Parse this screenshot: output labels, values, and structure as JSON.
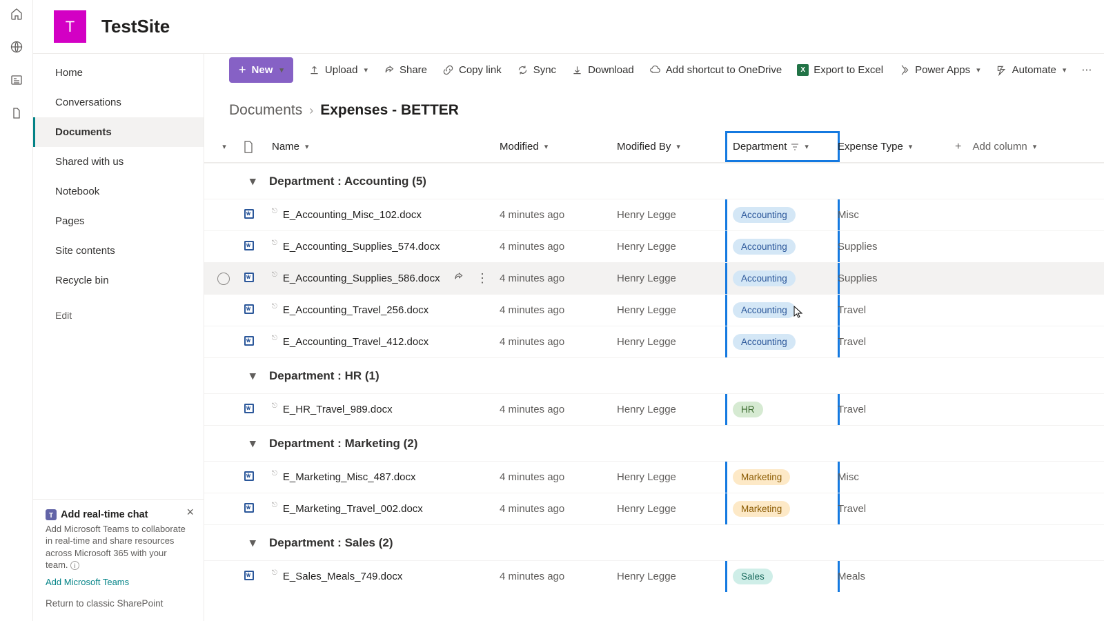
{
  "site": {
    "logo_letter": "T",
    "title": "TestSite"
  },
  "rail": {
    "home": "home-icon",
    "globe": "globe-icon",
    "news": "news-icon",
    "doc": "files-icon"
  },
  "nav": {
    "items": [
      "Home",
      "Conversations",
      "Documents",
      "Shared with us",
      "Notebook",
      "Pages",
      "Site contents",
      "Recycle bin"
    ],
    "active_index": 2,
    "edit": "Edit"
  },
  "promo": {
    "title": "Add real-time chat",
    "desc": "Add Microsoft Teams to collaborate in real-time and share resources across Microsoft 365 with your team.",
    "link": "Add Microsoft Teams"
  },
  "classic_link": "Return to classic SharePoint",
  "commands": {
    "new": "New",
    "upload": "Upload",
    "share": "Share",
    "copylink": "Copy link",
    "sync": "Sync",
    "download": "Download",
    "shortcut": "Add shortcut to OneDrive",
    "export": "Export to Excel",
    "powerapps": "Power Apps",
    "automate": "Automate"
  },
  "breadcrumb": {
    "root": "Documents",
    "leaf": "Expenses - BETTER"
  },
  "columns": {
    "name": "Name",
    "modified": "Modified",
    "modifiedby": "Modified By",
    "department": "Department",
    "expensetype": "Expense Type",
    "add": "Add column"
  },
  "groups": [
    {
      "title": "Department : Accounting (5)",
      "dept_class": "acc",
      "rows": [
        {
          "name": "E_Accounting_Misc_102.docx",
          "mod": "4 minutes ago",
          "by": "Henry Legge",
          "dept": "Accounting",
          "type": "Misc"
        },
        {
          "name": "E_Accounting_Supplies_574.docx",
          "mod": "4 minutes ago",
          "by": "Henry Legge",
          "dept": "Accounting",
          "type": "Supplies"
        },
        {
          "name": "E_Accounting_Supplies_586.docx",
          "mod": "4 minutes ago",
          "by": "Henry Legge",
          "dept": "Accounting",
          "type": "Supplies",
          "hovered": true
        },
        {
          "name": "E_Accounting_Travel_256.docx",
          "mod": "4 minutes ago",
          "by": "Henry Legge",
          "dept": "Accounting",
          "type": "Travel"
        },
        {
          "name": "E_Accounting_Travel_412.docx",
          "mod": "4 minutes ago",
          "by": "Henry Legge",
          "dept": "Accounting",
          "type": "Travel"
        }
      ]
    },
    {
      "title": "Department : HR (1)",
      "dept_class": "hr",
      "rows": [
        {
          "name": "E_HR_Travel_989.docx",
          "mod": "4 minutes ago",
          "by": "Henry Legge",
          "dept": "HR",
          "type": "Travel"
        }
      ]
    },
    {
      "title": "Department : Marketing (2)",
      "dept_class": "mkt",
      "rows": [
        {
          "name": "E_Marketing_Misc_487.docx",
          "mod": "4 minutes ago",
          "by": "Henry Legge",
          "dept": "Marketing",
          "type": "Misc"
        },
        {
          "name": "E_Marketing_Travel_002.docx",
          "mod": "4 minutes ago",
          "by": "Henry Legge",
          "dept": "Marketing",
          "type": "Travel"
        }
      ]
    },
    {
      "title": "Department : Sales (2)",
      "dept_class": "sls",
      "rows": [
        {
          "name": "E_Sales_Meals_749.docx",
          "mod": "4 minutes ago",
          "by": "Henry Legge",
          "dept": "Sales",
          "type": "Meals"
        }
      ]
    }
  ]
}
